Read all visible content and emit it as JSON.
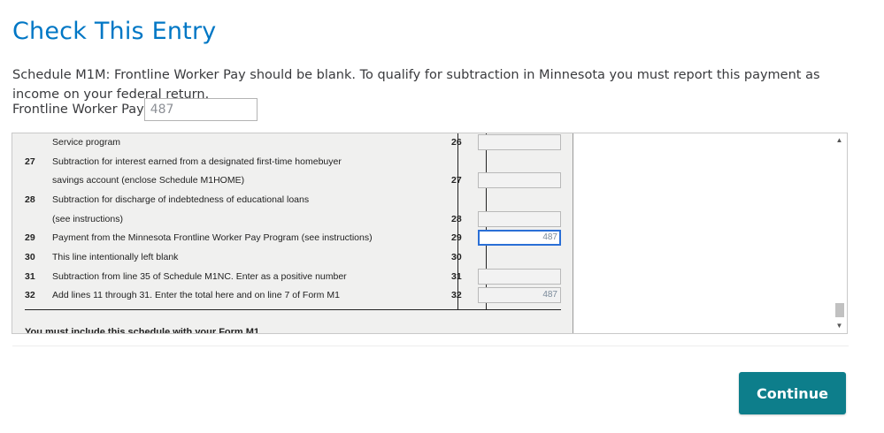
{
  "page": {
    "title": "Check This Entry",
    "message": "Schedule M1M: Frontline Worker Pay should be blank. To qualify for subtraction in Minnesota you must report this payment as income on your federal return."
  },
  "field": {
    "label": "Frontline Worker Pay",
    "value": "487"
  },
  "form": {
    "rows": [
      {
        "num": "",
        "desc": "Service program",
        "col": "26",
        "amount": "",
        "has_box": true,
        "active": false
      },
      {
        "num": "27",
        "desc": "Subtraction for interest earned from a designated first-time homebuyer",
        "col": "",
        "amount": "",
        "has_box": false,
        "active": false
      },
      {
        "num": "",
        "desc": "savings account (enclose Schedule M1HOME)",
        "col": "27",
        "amount": "",
        "has_box": true,
        "active": false
      },
      {
        "num": "28",
        "desc": "Subtraction for discharge of indebtedness of educational loans",
        "col": "",
        "amount": "",
        "has_box": false,
        "active": false
      },
      {
        "num": "",
        "desc": "(see instructions)",
        "col": "28",
        "amount": "",
        "has_box": true,
        "active": false
      },
      {
        "num": "29",
        "desc": "Payment from the Minnesota Frontline Worker Pay Program (see instructions)",
        "col": "29",
        "amount": "487",
        "has_box": true,
        "active": true
      },
      {
        "num": "30",
        "desc": "This line intentionally left blank",
        "col": "30",
        "amount": "",
        "has_box": false,
        "active": false
      },
      {
        "num": "31",
        "desc": "Subtraction from line 35 of Schedule M1NC. Enter as a positive number",
        "col": "31",
        "amount": "",
        "has_box": true,
        "active": false
      },
      {
        "num": "32",
        "desc": "Add lines 11 through 31. Enter the total here and on line 7 of Form M1",
        "col": "32",
        "amount": "487",
        "has_box": true,
        "active": false
      }
    ],
    "footer_note": "You must include this schedule with your Form M1."
  },
  "actions": {
    "continue_label": "Continue"
  },
  "colors": {
    "accent": "#0077c5",
    "button": "#0d7e8b"
  }
}
